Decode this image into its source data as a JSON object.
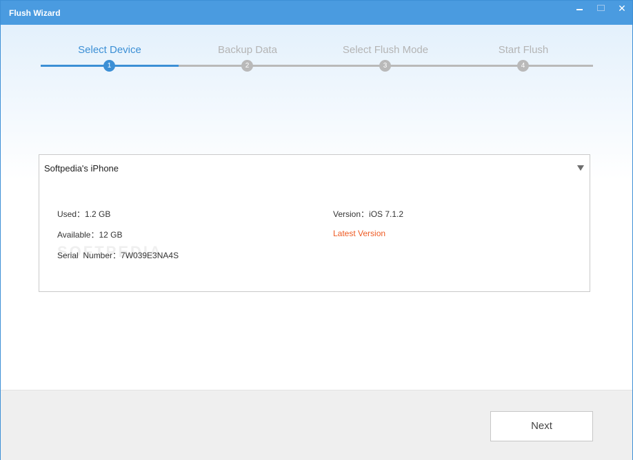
{
  "window": {
    "title": "Flush Wizard",
    "controls": {
      "minimize_icon": "minimize-icon",
      "maximize_icon": "maximize-icon",
      "close": "✕"
    }
  },
  "steps": [
    {
      "label": "Select Device",
      "number": "1",
      "active": true
    },
    {
      "label": "Backup Data",
      "number": "2",
      "active": false
    },
    {
      "label": "Select Flush Mode",
      "number": "3",
      "active": false
    },
    {
      "label": "Start Flush",
      "number": "4",
      "active": false
    }
  ],
  "device": {
    "selected": "Softpedia's iPhone",
    "used": "Used：1.2 GB",
    "available": "Available：12 GB",
    "serial": "Serial  Number：7W039E3NA4S",
    "version": "Version：iOS 7.1.2",
    "version_status": "Latest Version"
  },
  "watermark": "SOFTPEDIA",
  "footer": {
    "next_label": "Next"
  },
  "colors": {
    "accent": "#3b8fd5",
    "titlebar": "#4a9be0",
    "inactive": "#b9b9b9",
    "status_orange": "#ee5a22"
  }
}
